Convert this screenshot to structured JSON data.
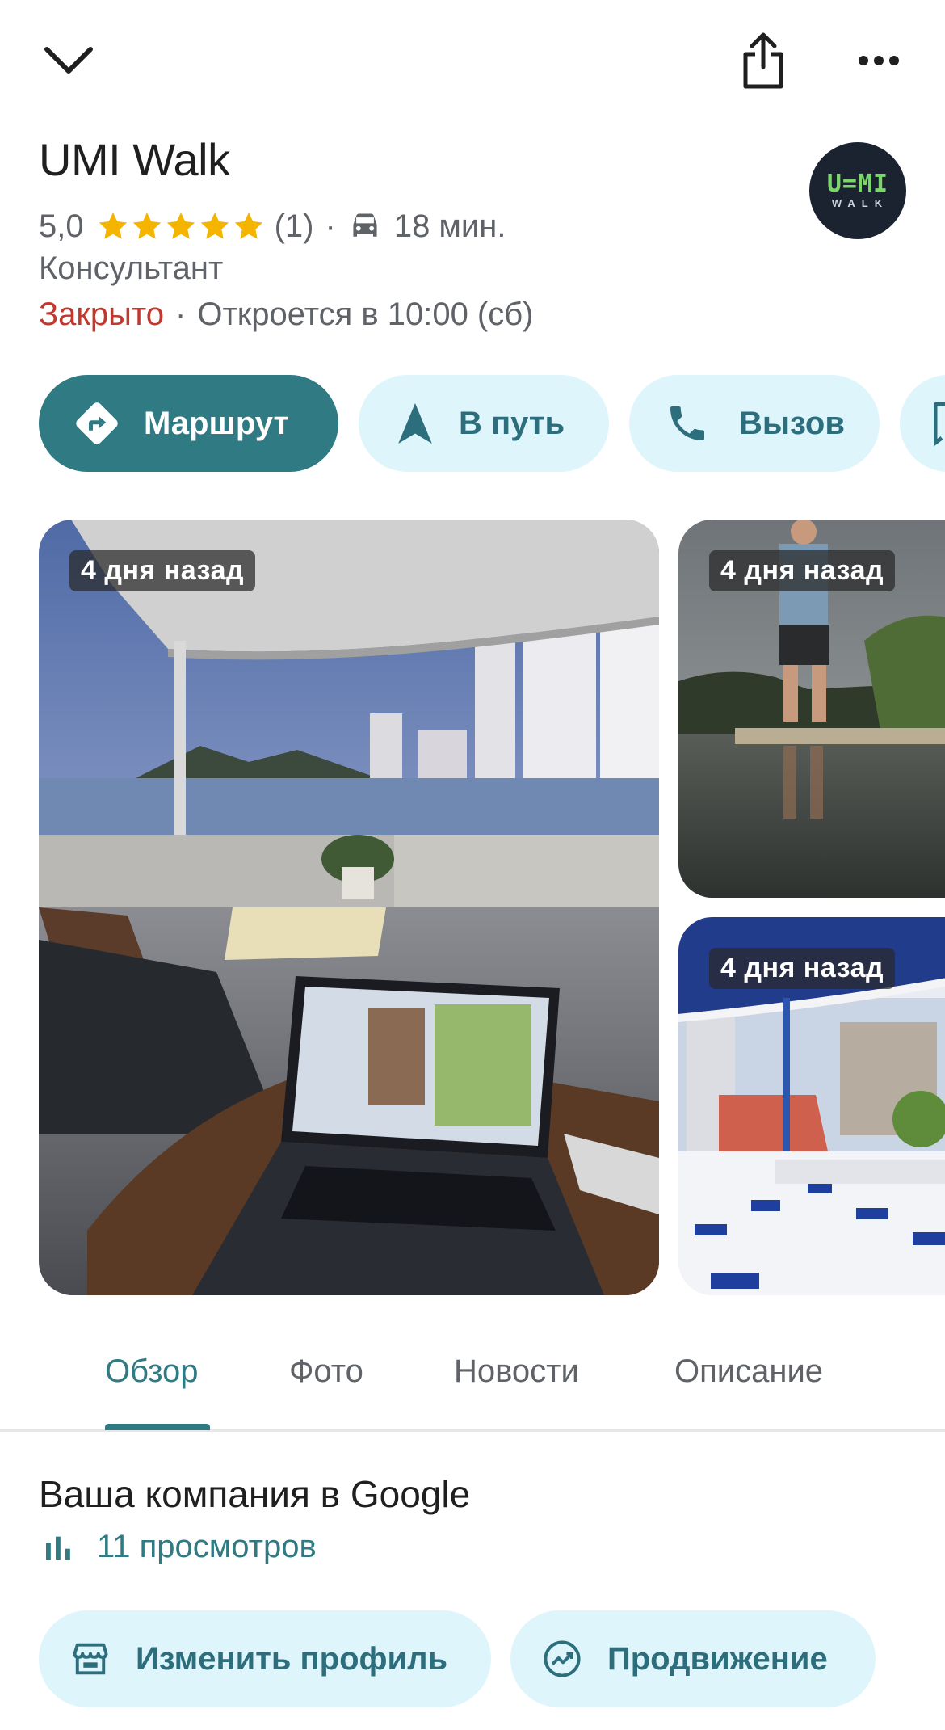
{
  "header": {
    "collapse_icon": "chevron-down-icon",
    "share_icon": "share-icon",
    "more_icon": "more-horizontal-icon"
  },
  "place": {
    "name": "UMI Walk",
    "logo_text_top": "U=MI",
    "logo_text_bottom": "WALK",
    "rating": "5,0",
    "rating_stars": 5,
    "reviews_count": "(1)",
    "separator": "·",
    "drive_time": "18 мин.",
    "category": "Консультант",
    "status": "Закрыто",
    "status_separator": "·",
    "opens": "Откроется в 10:00 (сб)"
  },
  "actions": [
    {
      "label": "Маршрут",
      "icon": "directions-icon"
    },
    {
      "label": "В путь",
      "icon": "navigation-arrow-icon"
    },
    {
      "label": "Вызов",
      "icon": "phone-icon"
    }
  ],
  "photos": [
    {
      "badge": "4 дня назад",
      "subject": "rooftop terrace with laptop"
    },
    {
      "badge": "4 дня назад",
      "subject": "man standing by water"
    },
    {
      "badge": "4 дня назад",
      "subject": "cafe terrace with blue chairs"
    }
  ],
  "tabs": [
    {
      "label": "Обзор",
      "active": true
    },
    {
      "label": "Фото",
      "active": false
    },
    {
      "label": "Новости",
      "active": false
    },
    {
      "label": "Описание",
      "active": false
    }
  ],
  "business": {
    "title": "Ваша компания в Google",
    "views": "11 просмотров",
    "buttons": [
      {
        "label": "Изменить профиль",
        "icon": "storefront-icon"
      },
      {
        "label": "Продвижение",
        "icon": "trending-up-icon"
      }
    ]
  },
  "colors": {
    "accent": "#2f7a83",
    "chip_bg": "#dff5fc",
    "closed": "#c5372c",
    "star": "#f4b400"
  }
}
